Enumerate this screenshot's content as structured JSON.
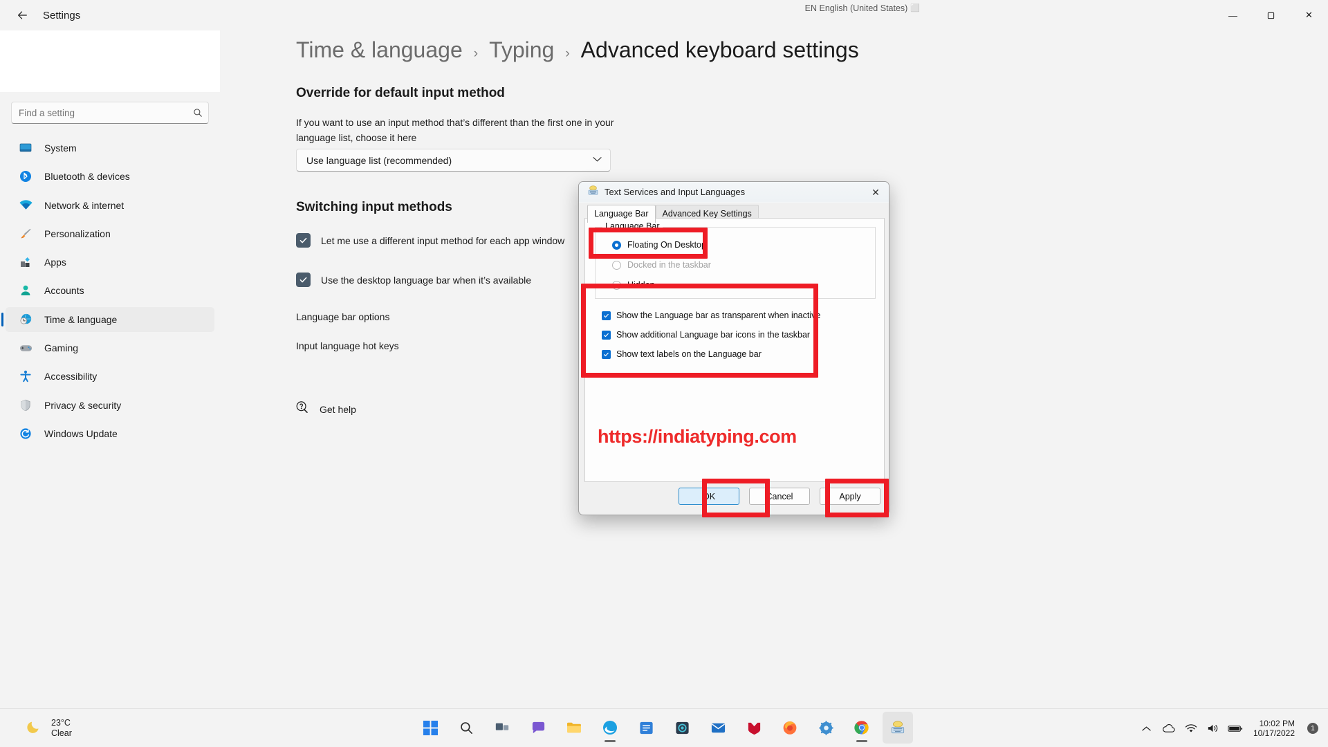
{
  "window": {
    "app_title": "Settings",
    "back_icon": "back-arrow-icon",
    "minimize_label": "—",
    "maximize_label": "❐",
    "close_label": "✕",
    "language_indicator": "EN English (United States)"
  },
  "search": {
    "placeholder": "Find a setting",
    "value": "",
    "icon": "search-icon"
  },
  "sidebar": {
    "items": [
      {
        "label": "System",
        "icon": "monitor-icon",
        "active": false
      },
      {
        "label": "Bluetooth & devices",
        "icon": "bluetooth-icon",
        "active": false
      },
      {
        "label": "Network & internet",
        "icon": "wifi-icon",
        "active": false
      },
      {
        "label": "Personalization",
        "icon": "paintbrush-icon",
        "active": false
      },
      {
        "label": "Apps",
        "icon": "apps-icon",
        "active": false
      },
      {
        "label": "Accounts",
        "icon": "person-icon",
        "active": false
      },
      {
        "label": "Time & language",
        "icon": "clock-globe-icon",
        "active": true
      },
      {
        "label": "Gaming",
        "icon": "gamepad-icon",
        "active": false
      },
      {
        "label": "Accessibility",
        "icon": "accessibility-icon",
        "active": false
      },
      {
        "label": "Privacy & security",
        "icon": "shield-icon",
        "active": false
      },
      {
        "label": "Windows Update",
        "icon": "update-icon",
        "active": false
      }
    ]
  },
  "breadcrumb": {
    "items": [
      "Time & language",
      "Typing",
      "Advanced keyboard settings"
    ],
    "separator": "›"
  },
  "main": {
    "override_heading": "Override for default input method",
    "override_desc": "If you want to use an input method that’s different than the first one in your language list, choose it here",
    "override_value": "Use language list (recommended)",
    "override_chevron": "chevron-down-icon",
    "switching_heading": "Switching input methods",
    "checkbox_app_window": "Let me use a different input method for each app window",
    "checkbox_desktop_bar": "Use the desktop language bar when it’s available",
    "link_language_bar_options": "Language bar options",
    "link_hot_keys": "Input language hot keys",
    "get_help": "Get help",
    "get_help_icon": "help-icon"
  },
  "dialog": {
    "title": "Text Services and Input Languages",
    "title_icon": "keyboard-icon",
    "close_label": "✕",
    "tabs": [
      {
        "label": "Language Bar",
        "active": true
      },
      {
        "label": "Advanced Key Settings",
        "active": false
      }
    ],
    "group_legend": "Language Bar",
    "radios": [
      {
        "label": "Floating On Desktop",
        "selected": true,
        "disabled": false
      },
      {
        "label": "Docked in the taskbar",
        "selected": false,
        "disabled": true
      },
      {
        "label": "Hidden",
        "selected": false,
        "disabled": false
      }
    ],
    "checkboxes": [
      {
        "label": "Show the Language bar as transparent when inactive",
        "checked": true
      },
      {
        "label": "Show additional Language bar icons in the taskbar",
        "checked": true
      },
      {
        "label": "Show text labels on the Language bar",
        "checked": true
      }
    ],
    "watermark": "https://indiatyping.com",
    "buttons": [
      {
        "label": "OK",
        "default": true
      },
      {
        "label": "Cancel",
        "default": false
      },
      {
        "label": "Apply",
        "default": false
      }
    ]
  },
  "taskbar": {
    "weather_temp": "23°C",
    "weather_condition": "Clear",
    "weather_icon": "moon-icon",
    "apps": [
      {
        "name": "start-button",
        "icon": "windows-logo-icon"
      },
      {
        "name": "search-taskbar",
        "icon": "search-icon"
      },
      {
        "name": "task-view",
        "icon": "task-view-icon"
      },
      {
        "name": "chat",
        "icon": "chat-icon"
      },
      {
        "name": "file-explorer",
        "icon": "folder-icon"
      },
      {
        "name": "edge",
        "icon": "edge-icon"
      },
      {
        "name": "microsoft-store",
        "icon": "store-icon"
      },
      {
        "name": "photos",
        "icon": "photos-icon"
      },
      {
        "name": "mail",
        "icon": "mail-icon"
      },
      {
        "name": "mcafee",
        "icon": "mcafee-icon"
      },
      {
        "name": "firefox",
        "icon": "firefox-icon"
      },
      {
        "name": "settings",
        "icon": "gear-icon"
      },
      {
        "name": "chrome",
        "icon": "chrome-icon"
      },
      {
        "name": "keyboard-app",
        "icon": "keyboard-icon"
      }
    ],
    "tray": [
      {
        "name": "show-hidden-icons",
        "icon": "chevron-up-icon"
      },
      {
        "name": "onedrive",
        "icon": "cloud-icon"
      },
      {
        "name": "network",
        "icon": "wifi-icon"
      },
      {
        "name": "volume",
        "icon": "speaker-icon"
      },
      {
        "name": "battery",
        "icon": "battery-icon"
      }
    ],
    "time": "10:02 PM",
    "date": "10/17/2022",
    "notification_count": "1"
  },
  "colors": {
    "accent": "#005fb8",
    "annotation_red": "#ee1c25",
    "watermark_red": "#ee2b2b",
    "checkbox_settings": "#4a5b6b",
    "checkbox_dialog": "#0a6fd1"
  }
}
